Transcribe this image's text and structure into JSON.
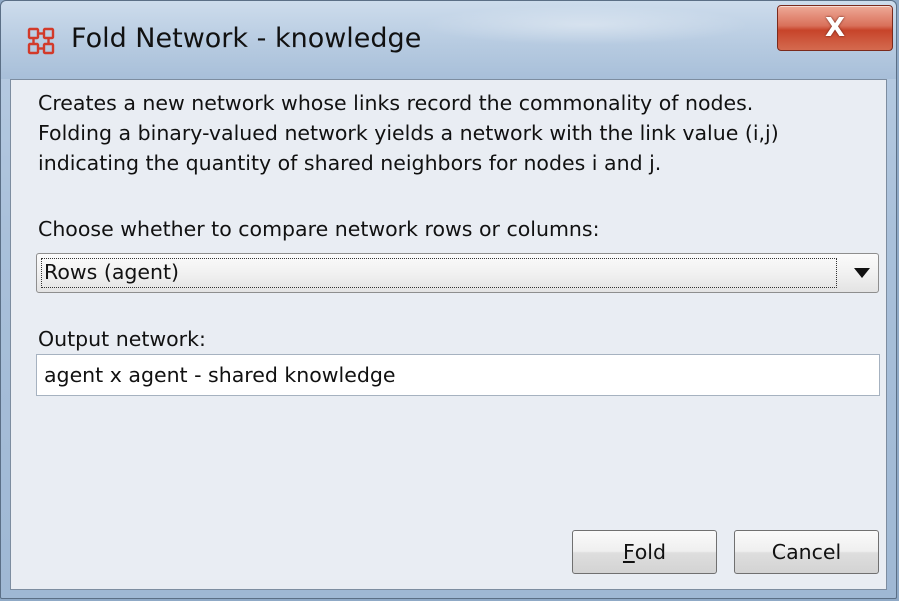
{
  "window": {
    "title": "Fold Network - knowledge",
    "close_label": "X"
  },
  "dialog": {
    "description_lines": [
      "Creates a new network whose links record the commonality of nodes.",
      "Folding a binary-valued network yields a network with the link value (i,j)",
      "indicating the quantity of shared neighbors for nodes i and j."
    ],
    "choose_label": "Choose whether to compare network rows or columns:",
    "choose_selected": "Rows (agent)",
    "output_label": "Output network:",
    "output_value": "agent x agent - shared knowledge"
  },
  "buttons": {
    "fold_mnemonic": "F",
    "fold_rest": "old",
    "cancel_label": "Cancel"
  },
  "icons": {
    "app": "network-grid-icon",
    "dropdown": "chevron-down-icon"
  },
  "colors": {
    "close_button": "#c7442a",
    "content_bg": "#e9edf3",
    "app_icon": "#d23a2a"
  }
}
